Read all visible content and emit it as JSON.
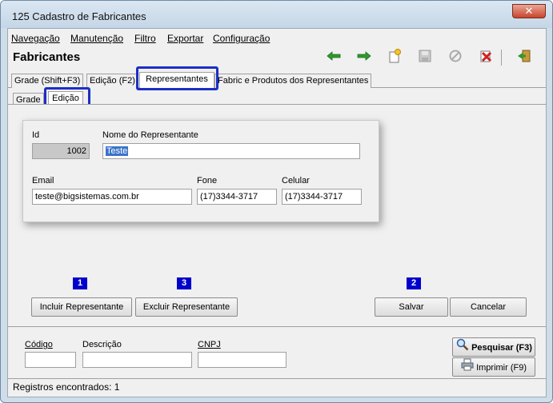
{
  "window": {
    "title": "125 Cadastro de Fabricantes",
    "close_glyph": "✕"
  },
  "menu": [
    "Navegação",
    "Manutenção",
    "Filtro",
    "Exportar",
    "Configuração"
  ],
  "header": {
    "title": "Fabricantes"
  },
  "toolbar": {
    "icons": [
      "arrow-left-icon",
      "arrow-right-icon",
      "new-icon",
      "save-icon",
      "cancel-icon",
      "delete-icon",
      "exit-icon"
    ]
  },
  "tabs": [
    {
      "label": "Grade (Shift+F3)"
    },
    {
      "label": "Edição (F2)"
    },
    {
      "label": "Representantes"
    },
    {
      "label": "Fabric e Produtos dos Representantes"
    }
  ],
  "subtabs": [
    {
      "label": "Grade"
    },
    {
      "label": "Edição"
    }
  ],
  "form": {
    "id_label": "Id",
    "id_value": "1002",
    "nome_label": "Nome do Representante",
    "nome_value": "Teste",
    "email_label": "Email",
    "email_value": "teste@bigsistemas.com.br",
    "fone_label": "Fone",
    "fone_value": "(17)3344-3717",
    "celular_label": "Celular",
    "celular_value": "(17)3344-3717"
  },
  "badges": [
    "1",
    "3",
    "2"
  ],
  "buttons": {
    "incluir": "Incluir Representante",
    "excluir": "Excluir Representante",
    "salvar": "Salvar",
    "cancelar": "Cancelar"
  },
  "search": {
    "codigo_label": "Código",
    "descricao_label": "Descrição",
    "cnpj_label": "CNPJ",
    "pesquisar": "Pesquisar (F3)",
    "imprimir": "Imprimir (F9)"
  },
  "status": {
    "text": "Registros encontrados: 1"
  },
  "colors": {
    "highlight": "#1c2fc4",
    "badge": "#0000cc",
    "selection": "#3a73c9"
  }
}
